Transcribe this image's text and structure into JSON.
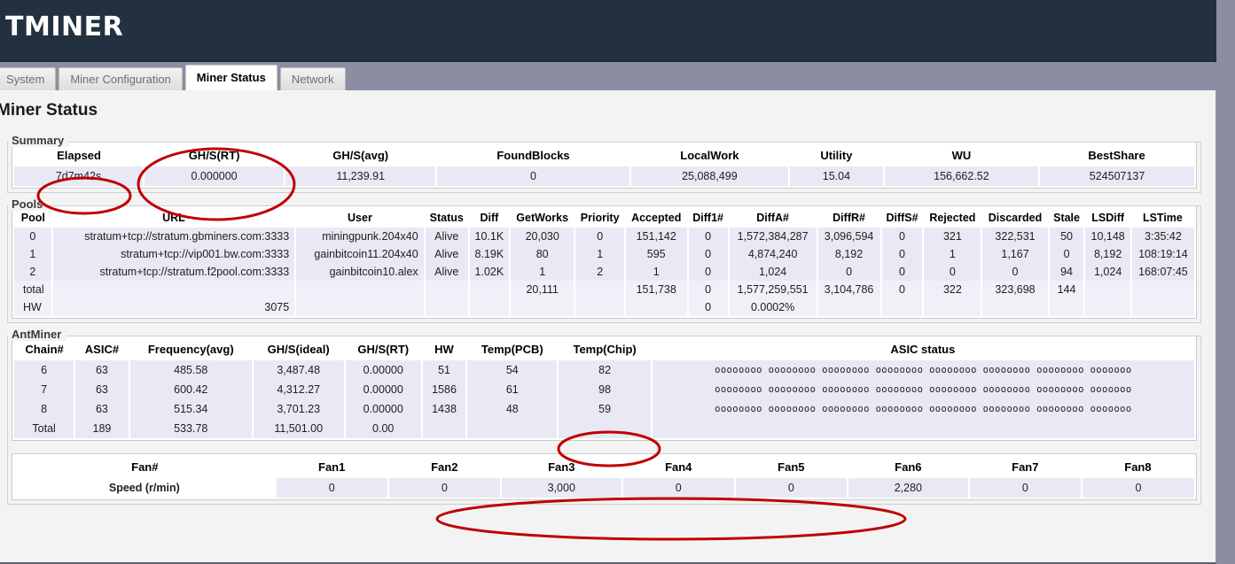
{
  "brand": {
    "logo_text": "TMINER",
    "logo_icon": "ant-icon"
  },
  "tabs": [
    {
      "label": "System",
      "active": false
    },
    {
      "label": "Miner Configuration",
      "active": false
    },
    {
      "label": "Miner Status",
      "active": true
    },
    {
      "label": "Network",
      "active": false
    }
  ],
  "page_title": "Miner Status",
  "summary": {
    "legend": "Summary",
    "headers": [
      "Elapsed",
      "GH/S(RT)",
      "GH/S(avg)",
      "FoundBlocks",
      "LocalWork",
      "Utility",
      "WU",
      "BestShare"
    ],
    "values": [
      "7d7m42s",
      "0.000000",
      "11,239.91",
      "0",
      "25,088,499",
      "15.04",
      "156,662.52",
      "524507137"
    ]
  },
  "pools": {
    "legend": "Pools",
    "headers": [
      "Pool",
      "URL",
      "User",
      "Status",
      "Diff",
      "GetWorks",
      "Priority",
      "Accepted",
      "Diff1#",
      "DiffA#",
      "DiffR#",
      "DiffS#",
      "Rejected",
      "Discarded",
      "Stale",
      "LSDiff",
      "LSTime"
    ],
    "rows": [
      [
        "0",
        "stratum+tcp://stratum.gbminers.com:3333",
        "miningpunk.204x40",
        "Alive",
        "10.1K",
        "20,030",
        "0",
        "151,142",
        "0",
        "1,572,384,287",
        "3,096,594",
        "0",
        "321",
        "322,531",
        "50",
        "10,148",
        "3:35:42"
      ],
      [
        "1",
        "stratum+tcp://vip001.bw.com:3333",
        "gainbitcoin11.204x40",
        "Alive",
        "8.19K",
        "80",
        "1",
        "595",
        "0",
        "4,874,240",
        "8,192",
        "0",
        "1",
        "1,167",
        "0",
        "8,192",
        "108:19:14"
      ],
      [
        "2",
        "stratum+tcp://stratum.f2pool.com:3333",
        "gainbitcoin10.alex",
        "Alive",
        "1.02K",
        "1",
        "2",
        "1",
        "0",
        "1,024",
        "0",
        "0",
        "0",
        "0",
        "94",
        "1,024",
        "168:07:45"
      ],
      [
        "total",
        "",
        "",
        "",
        "",
        "20,111",
        "",
        "151,738",
        "0",
        "1,577,259,551",
        "3,104,786",
        "0",
        "322",
        "323,698",
        "144",
        "",
        ""
      ],
      [
        "HW",
        "3075",
        "",
        "",
        "",
        "",
        "",
        "",
        "0",
        "0.0002%",
        "",
        "",
        "",
        "",
        "",
        "",
        ""
      ]
    ]
  },
  "antminer": {
    "legend": "AntMiner",
    "chain_headers": [
      "Chain#",
      "ASIC#",
      "Frequency(avg)",
      "GH/S(ideal)",
      "GH/S(RT)",
      "HW",
      "Temp(PCB)",
      "Temp(Chip)",
      "ASIC status"
    ],
    "asic_status_value": "oooooooo oooooooo oooooooo oooooooo oooooooo oooooooo oooooooo ooooooo",
    "chain_rows": [
      [
        "6",
        "63",
        "485.58",
        "3,487.48",
        "0.00000",
        "51",
        "54",
        "82"
      ],
      [
        "7",
        "63",
        "600.42",
        "4,312.27",
        "0.00000",
        "1586",
        "61",
        "98"
      ],
      [
        "8",
        "63",
        "515.34",
        "3,701.23",
        "0.00000",
        "1438",
        "48",
        "59"
      ],
      [
        "Total",
        "189",
        "533.78",
        "11,501.00",
        "0.00",
        "",
        "",
        ""
      ]
    ],
    "fan_headers": [
      "Fan#",
      "Fan1",
      "Fan2",
      "Fan3",
      "Fan4",
      "Fan5",
      "Fan6",
      "Fan7",
      "Fan8"
    ],
    "fan_row_label": "Speed (r/min)",
    "fan_values": [
      "0",
      "0",
      "3,000",
      "0",
      "0",
      "2,280",
      "0",
      "0"
    ]
  },
  "annotation_color": "#c00000"
}
